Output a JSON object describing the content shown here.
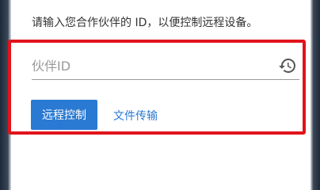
{
  "connect": {
    "instruction": "请输入您合作伙伴的 ID，以便控制远程设备。",
    "partner_id": {
      "value": "",
      "placeholder": "伙伴ID"
    },
    "history_icon": "history-icon",
    "remote_control_label": "远程控制",
    "file_transfer_label": "文件传输"
  },
  "colors": {
    "accent": "#2a7ad3",
    "highlight": "#e1141c",
    "text": "#333333",
    "placeholder": "#9a9a9a"
  }
}
